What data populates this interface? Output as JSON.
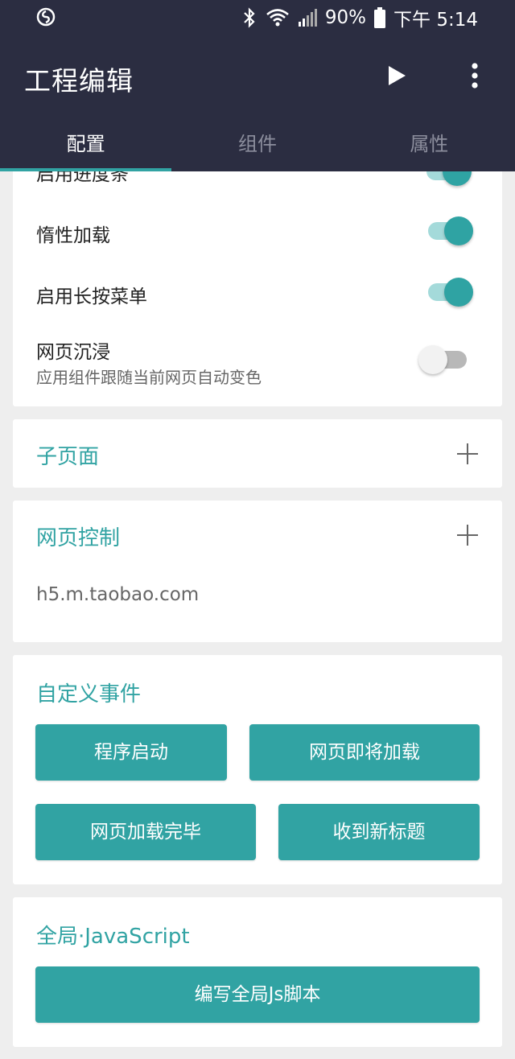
{
  "status_bar": {
    "battery": "90%",
    "time": "下午 5:14",
    "icons": [
      "app-notification-icon",
      "bluetooth-icon",
      "wifi-icon",
      "signal-icon",
      "battery-icon"
    ]
  },
  "toolbar": {
    "title": "工程编辑",
    "actions": [
      "play-icon",
      "more-vert-icon"
    ]
  },
  "tabs": [
    {
      "label": "配置",
      "active": true
    },
    {
      "label": "组件",
      "active": false
    },
    {
      "label": "属性",
      "active": false
    }
  ],
  "settings": {
    "partial_label": "启用进度条",
    "items": [
      {
        "label": "惰性加载",
        "on": true
      },
      {
        "label": "启用长按菜单",
        "on": true
      },
      {
        "label": "网页沉浸",
        "sub": "应用组件跟随当前网页自动变色",
        "on": false
      }
    ]
  },
  "subpage": {
    "title": "子页面"
  },
  "web_control": {
    "title": "网页控制",
    "url": "h5.m.taobao.com"
  },
  "events": {
    "title": "自定义事件",
    "buttons": [
      "程序启动",
      "网页即将加载",
      "网页加载完毕",
      "收到新标题"
    ]
  },
  "global_js": {
    "title": "全局·JavaScript",
    "button": "编写全局Js脚本"
  },
  "colors": {
    "appbar": "#2b2d41",
    "accent": "#31a3a3",
    "background": "#eeeeee"
  }
}
